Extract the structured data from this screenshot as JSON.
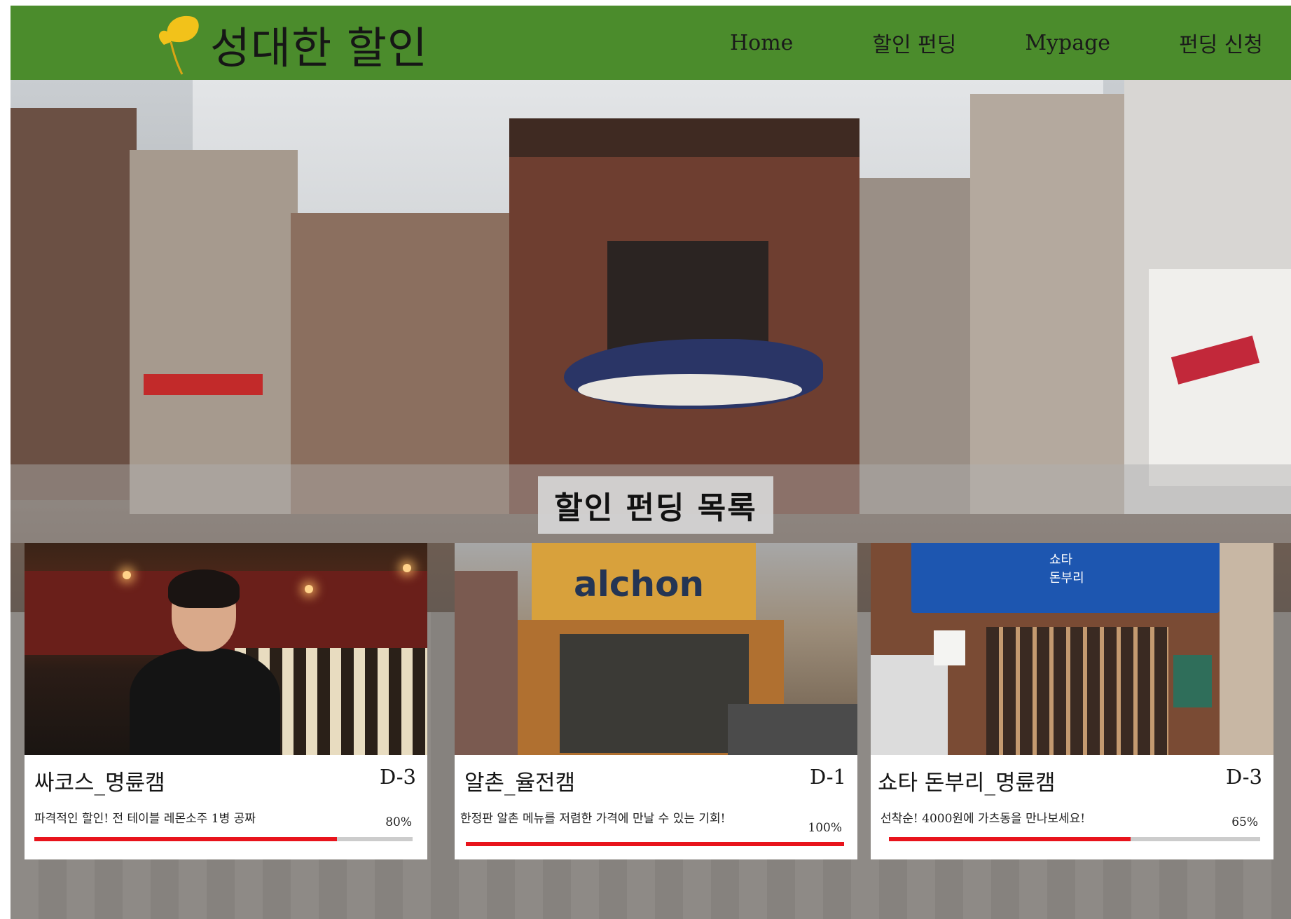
{
  "header": {
    "logo_text": "성대한 할인",
    "logo_icon": "ginkgo-leaf-icon",
    "nav": [
      {
        "label": "Home"
      },
      {
        "label": "할인 펀딩"
      },
      {
        "label": "Mypage"
      },
      {
        "label": "펀딩 신청"
      }
    ]
  },
  "section": {
    "title": "할인 펀딩 목록"
  },
  "cards": [
    {
      "name": "싸코스_명륜캠",
      "dday": "D-3",
      "description": "파격적인 할인! 전 테이블 레몬소주 1병 공짜",
      "percent_label": "80%",
      "progress": 0.8
    },
    {
      "name": "알촌_율전캠",
      "dday": "D-1",
      "description": "한정판 알촌 메뉴를 저렴한 가격에 만날 수 있는 기회!",
      "percent_label": "100%",
      "progress": 1.0
    },
    {
      "name": "쇼타 돈부리_명륜캠",
      "dday": "D-3",
      "description": "선착순! 4000원에 가츠동을 만나보세요!",
      "percent_label": "65%",
      "progress": 0.65
    }
  ],
  "colors": {
    "header_bg": "#4b8c2c",
    "progress_fill": "#e8141c",
    "progress_track": "#cccccc",
    "logo_leaf": "#f2c21a"
  }
}
